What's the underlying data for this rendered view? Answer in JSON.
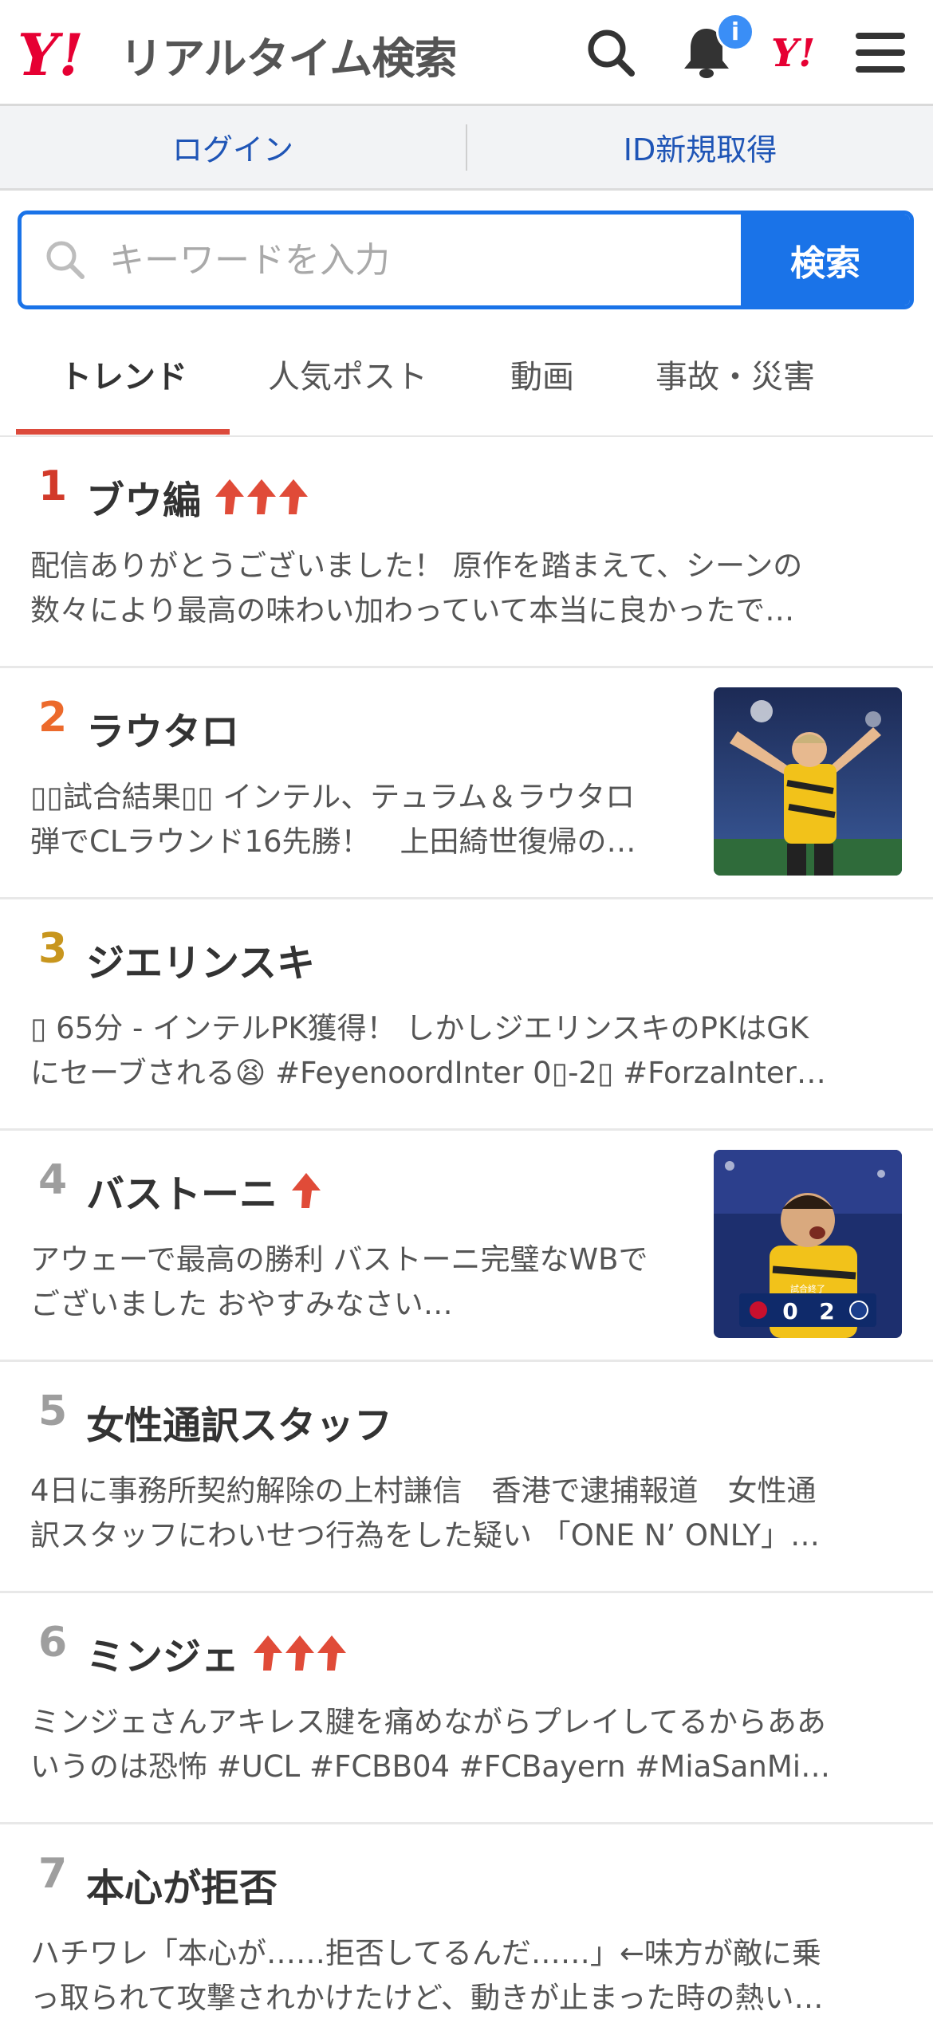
{
  "header": {
    "logo_text": "リアルタイム検索",
    "notification_count": "i",
    "yahoo_mark": "Y!"
  },
  "login": {
    "login_label": "ログイン",
    "signup_label": "ID新規取得"
  },
  "search": {
    "placeholder": "キーワードを入力",
    "button_label": "検索"
  },
  "tabs": [
    {
      "label": "トレンド",
      "active": true
    },
    {
      "label": "人気ポスト",
      "active": false
    },
    {
      "label": "動画",
      "active": false
    },
    {
      "label": "事故・災害",
      "active": false
    }
  ],
  "trends": [
    {
      "rank": "1",
      "term": "ブウ編",
      "arrows": 3,
      "line1": "配信ありがとうございました！ 原作を踏まえて、シーンの",
      "line2": "数々により最高の味わい加わっていて本当に良かったで…"
    },
    {
      "rank": "2",
      "term": "ラウタロ",
      "arrows": 0,
      "line1": "▯▯試合結果▯▯ インテル、テュラム＆ラウタロ",
      "line2": "弾でCLラウンド16先勝！　上田綺世復帰の…"
    },
    {
      "rank": "3",
      "term": "ジエリンスキ",
      "arrows": 0,
      "line1": "▯ 65分 - インテルPK獲得！ しかしジエリンスキのPKはGK",
      "line2": "にセーブされる😫 #FeyenoordInter 0▯-2▯ #ForzaInter…"
    },
    {
      "rank": "4",
      "term": "バストーニ",
      "arrows": 1,
      "line1": "アウェーで最高の勝利 バストーニ完璧なWBで",
      "line2": "ございました おやすみなさい…"
    },
    {
      "rank": "5",
      "term": "女性通訳スタッフ",
      "arrows": 0,
      "line1": "4日に事務所契約解除の上村謙信　香港で逮捕報道　女性通",
      "line2": "訳スタッフにわいせつ行為をした疑い 「ONE N’ ONLY」…"
    },
    {
      "rank": "6",
      "term": "ミンジェ",
      "arrows": 3,
      "line1": "ミンジェさんアキレス腱を痛めながらプレイしてるからああ",
      "line2": "いうのは恐怖 #UCL #FCBB04 #FCBayern #MiaSanMi…"
    },
    {
      "rank": "7",
      "term": "本心が拒否",
      "arrows": 0,
      "line1": "ハチワレ「本心が……拒否してるんだ……」←味方が敵に乗",
      "line2": "っ取られて攻撃されかけたけど、動きが止まった時の熱い…"
    }
  ],
  "thumb2": {
    "score_caption": "試合終了",
    "score_home": "0",
    "score_away": "2"
  },
  "colors": {
    "accent_blue": "#1a73e8",
    "yahoo_red": "#e60033",
    "rank1": "#d23a2a",
    "rank2": "#ec6a2c",
    "rank3": "#c8961e",
    "rank_other": "#9e9e9e",
    "tab_underline": "#dc4a3b"
  },
  "icons": [
    "search-icon",
    "bell-icon",
    "yahoo-logo-icon",
    "menu-icon",
    "up-arrow-icon"
  ]
}
